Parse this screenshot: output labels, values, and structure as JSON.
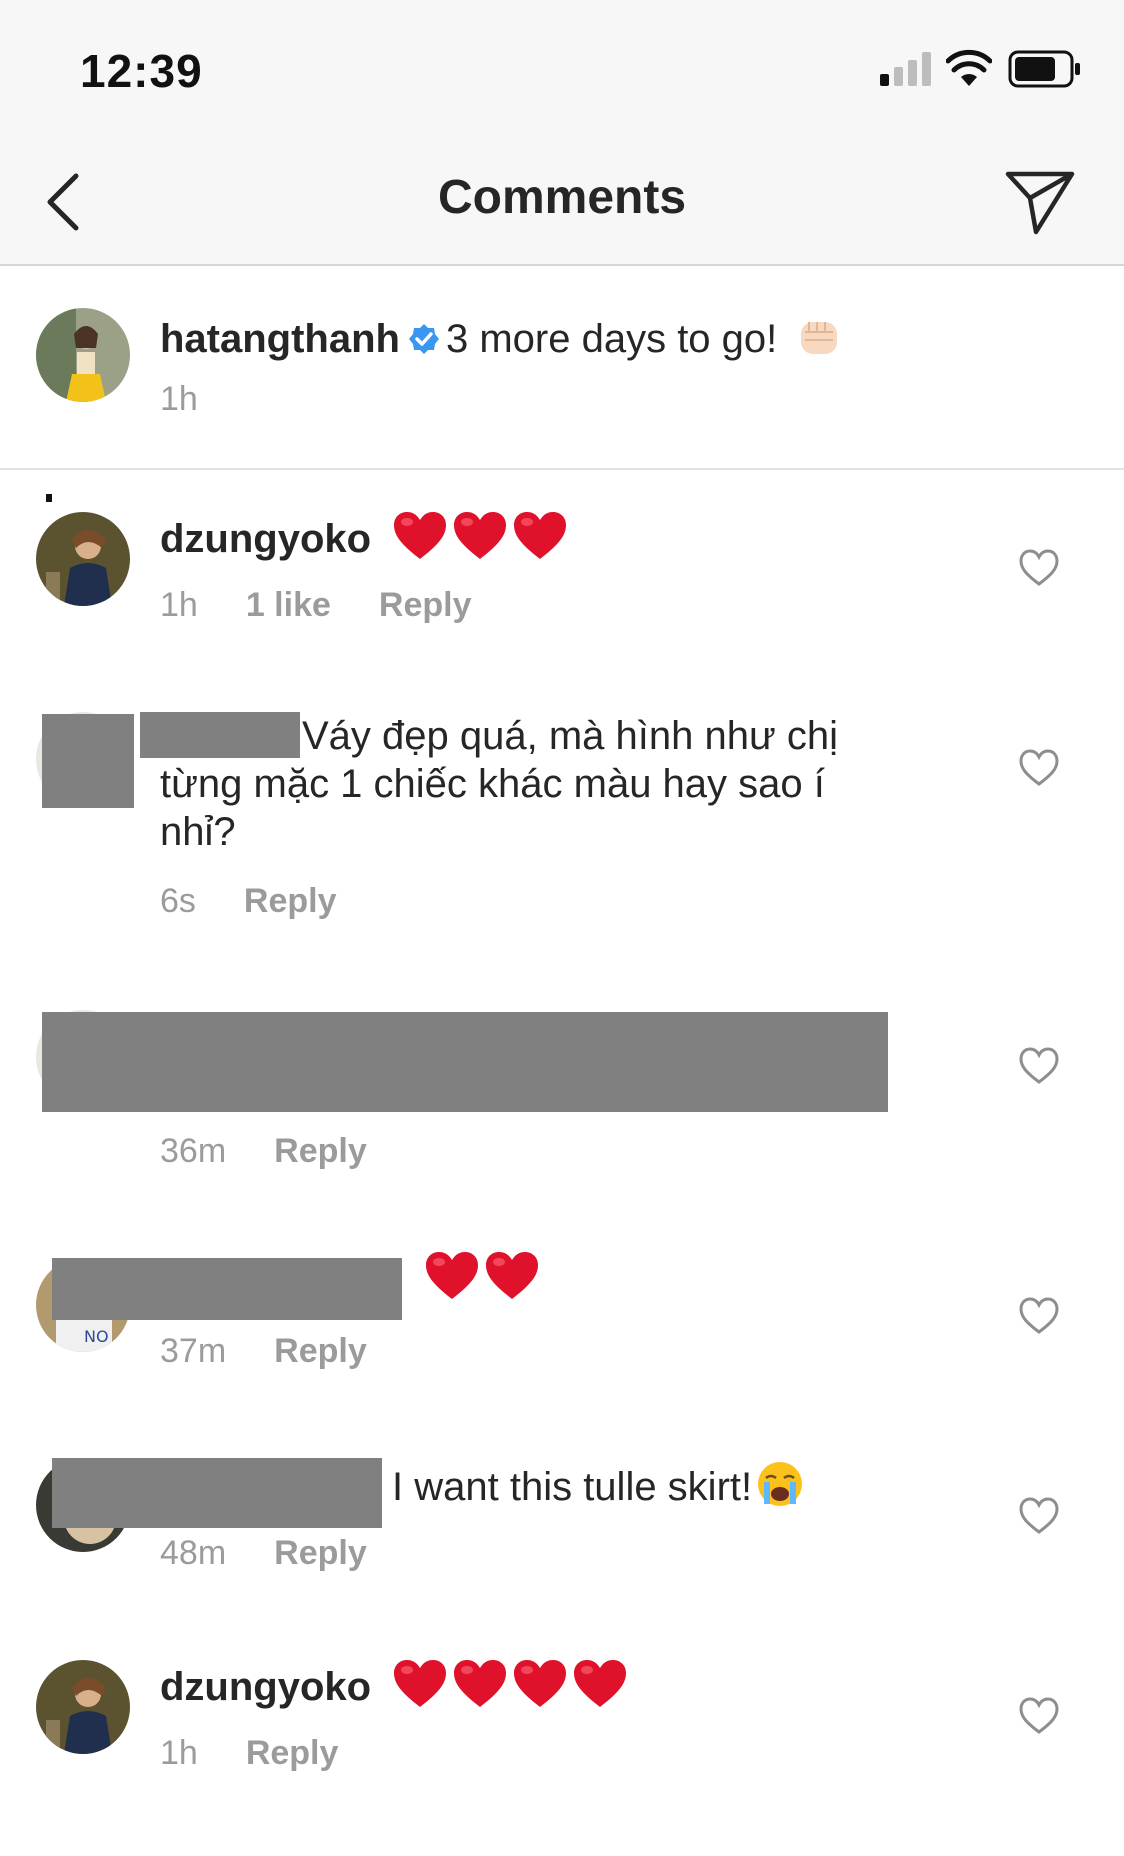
{
  "status_bar": {
    "time": "12:39",
    "icons": [
      "signal-icon",
      "wifi-icon",
      "battery-icon"
    ]
  },
  "nav": {
    "back_icon": "chevron-left-icon",
    "title": "Comments",
    "share_icon": "paper-plane-icon"
  },
  "caption": {
    "username": "hatangthanh",
    "verified": true,
    "text": "3 more days to go!",
    "emoji": "fist-emoji",
    "time": "1h"
  },
  "comments": [
    {
      "username": "dzungyoko",
      "text": "",
      "emoji": [
        "heart",
        "heart",
        "heart"
      ],
      "time": "1h",
      "likes": "1 like",
      "reply": "Reply"
    },
    {
      "username": "",
      "text": "Váy đẹp quá, mà hình như chị",
      "text_line2": "từng mặc 1 chiếc khác màu hay sao í",
      "text_line3": "nhỉ?",
      "time": "6s",
      "reply": "Reply"
    },
    {
      "username": "",
      "text": "",
      "time": "36m",
      "reply": "Reply"
    },
    {
      "username": "",
      "text": "",
      "emoji": [
        "heart",
        "heart"
      ],
      "time": "37m",
      "reply": "Reply"
    },
    {
      "username": "",
      "text": "I want this tulle skirt!",
      "emoji": [
        "crying-face"
      ],
      "time": "48m",
      "reply": "Reply"
    },
    {
      "username": "dzungyoko",
      "text": "",
      "emoji": [
        "heart",
        "heart",
        "heart",
        "heart"
      ],
      "time": "1h",
      "reply": "Reply"
    }
  ],
  "colors": {
    "text": "#262626",
    "meta": "#9b9b9b",
    "verified": "#3897f0",
    "heart": "#e0112b",
    "bar_bg": "#f7f7f7",
    "redaction": "#808080"
  }
}
